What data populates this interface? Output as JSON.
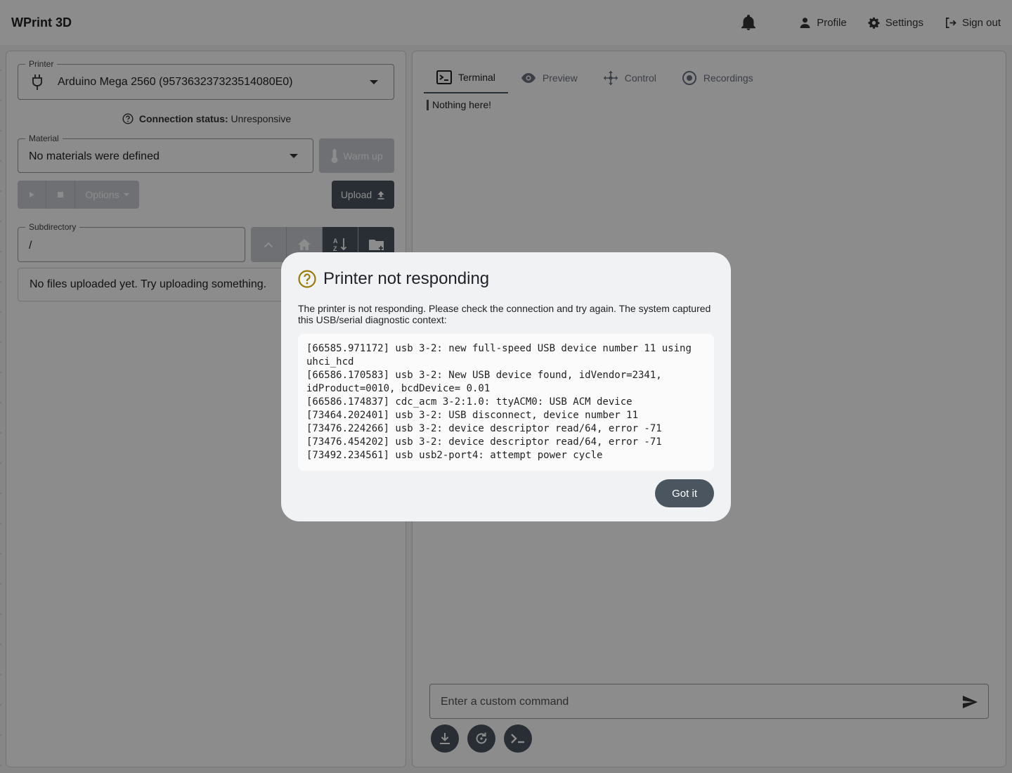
{
  "header": {
    "app_title": "WPrint 3D",
    "profile_label": "Profile",
    "settings_label": "Settings",
    "signout_label": "Sign out"
  },
  "left": {
    "printer_legend": "Printer",
    "printer_value": "Arduino Mega 2560 (957363237323514080E0)",
    "conn_status_label": "Connection status:",
    "conn_status_value": "Unresponsive",
    "material_legend": "Material",
    "material_value": "No materials were defined",
    "warm_up_label": "Warm up",
    "options_label": "Options",
    "upload_label": "Upload",
    "subdir_legend": "Subdirectory",
    "subdir_value": "/",
    "files_empty": "No files uploaded yet. Try uploading something."
  },
  "right": {
    "tabs": [
      {
        "label": "Terminal",
        "icon": "terminal-icon",
        "active": true
      },
      {
        "label": "Preview",
        "icon": "eye-icon",
        "active": false
      },
      {
        "label": "Control",
        "icon": "move-icon",
        "active": false
      },
      {
        "label": "Recordings",
        "icon": "record-icon",
        "active": false
      }
    ],
    "terminal_text": "Nothing here!",
    "cmd_placeholder": "Enter a custom command"
  },
  "modal": {
    "title": "Printer not responding",
    "text": "The printer is not responding. Please check the connection and try again. The system captured this USB/serial diagnostic context:",
    "log": "[66585.971172] usb 3-2: new full-speed USB device number 11 using uhci_hcd\n[66586.170583] usb 3-2: New USB device found, idVendor=2341, idProduct=0010, bcdDevice= 0.01\n[66586.174837] cdc_acm 3-2:1.0: ttyACM0: USB ACM device\n[73464.202401] usb 3-2: USB disconnect, device number 11\n[73476.224266] usb 3-2: device descriptor read/64, error -71\n[73476.454202] usb 3-2: device descriptor read/64, error -71\n[73492.234561] usb usb2-port4: attempt power cycle",
    "button_label": "Got it"
  },
  "colors": {
    "primary": "#4a5560",
    "warning_icon": "#9a7b0a",
    "overlay": "rgba(0,0,0,0.45)"
  }
}
